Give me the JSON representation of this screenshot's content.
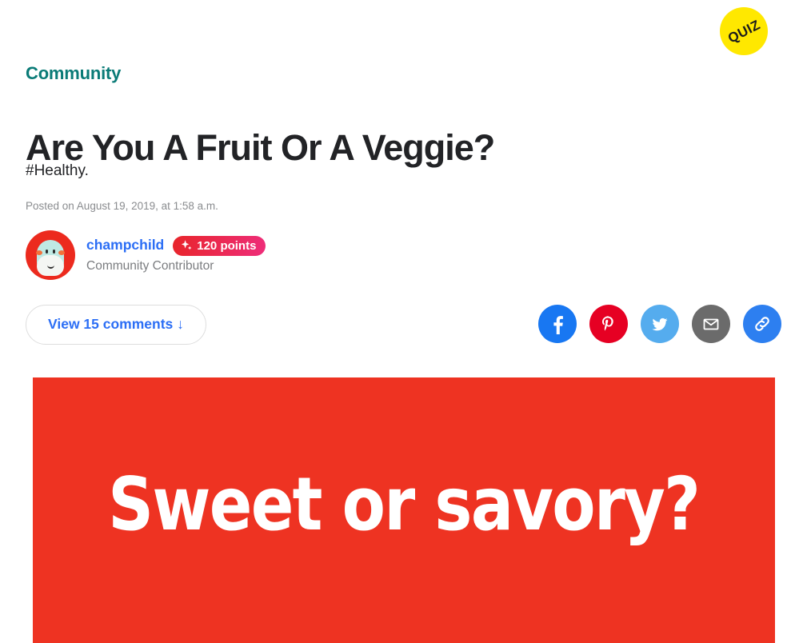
{
  "badge": {
    "label": "QUIZ",
    "color": "#ffe800",
    "text_color": "#1c1c1c"
  },
  "article": {
    "kicker": "Community",
    "kicker_color": "#0a7b77",
    "headline": "Are You A Fruit Or A Veggie?",
    "dek": "#Healthy.",
    "timestamp": "Posted on August 19, 2019, at 1:58 a.m."
  },
  "author": {
    "avatar_icon": "user-avatar",
    "username": "champchild",
    "username_color": "#2b6ef5",
    "points_label": "120 points",
    "points_icon": "sparkle-icon",
    "points_gradient_from": "#e8252a",
    "points_gradient_to": "#ee2d7a",
    "role": "Community Contributor"
  },
  "actions": {
    "comments_label": "View 15 comments ↓",
    "comments_color": "#2b6ef5"
  },
  "share": {
    "buttons": [
      {
        "name": "facebook",
        "label": "Share on Facebook",
        "color": "#1877f2"
      },
      {
        "name": "pinterest",
        "label": "Share on Pinterest",
        "color": "#e60023"
      },
      {
        "name": "twitter",
        "label": "Share on Twitter",
        "color": "#55acee"
      },
      {
        "name": "email",
        "label": "Share by Email",
        "color": "#6b6b6b"
      },
      {
        "name": "link",
        "label": "Copy Link",
        "color": "#2d7ff0"
      }
    ]
  },
  "hero": {
    "text": "Sweet or savory?",
    "background": "#ee3322",
    "text_color": "#ffffff"
  }
}
